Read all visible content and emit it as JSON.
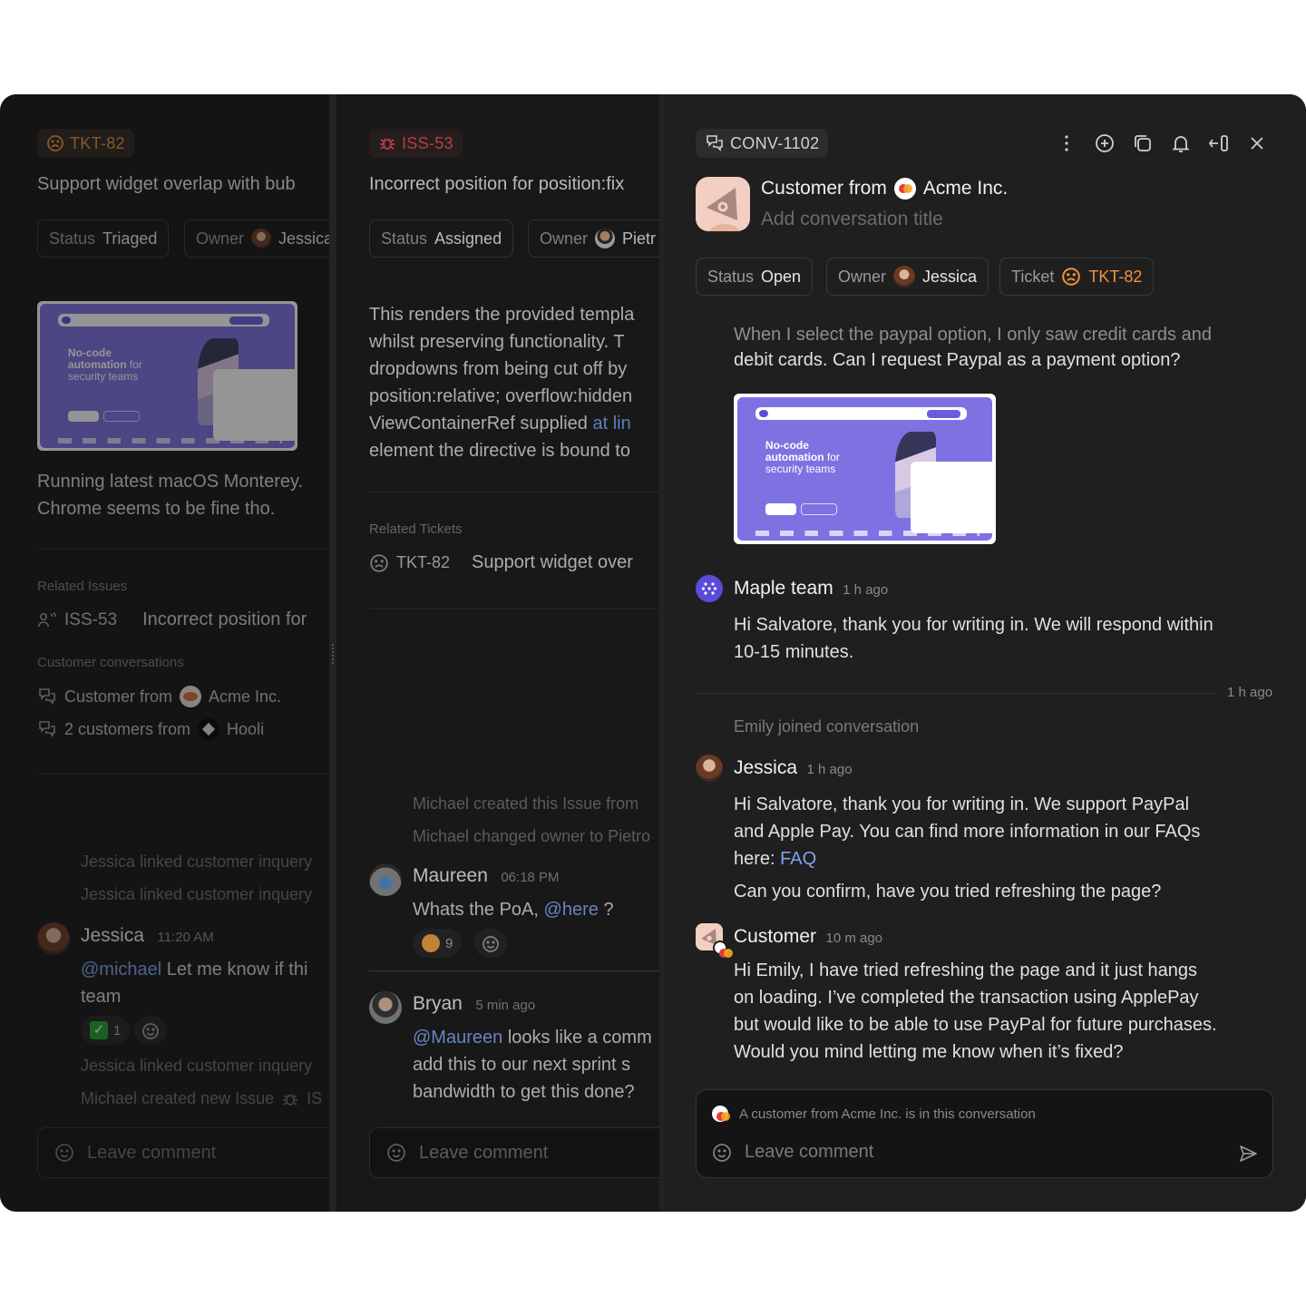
{
  "panels": {
    "ticket": {
      "id": "TKT-82",
      "title": "Support widget overlap with bub",
      "status_key": "Status",
      "status_value": "Triaged",
      "owner_key": "Owner",
      "owner_name": "Jessica",
      "description": [
        "Running latest macOS Monterey.",
        "Chrome seems to be fine tho."
      ],
      "attachment": {
        "headline_bold": "No-code automation",
        "headline_rest": "for security teams"
      },
      "related_issues_label": "Related Issues",
      "related_issues": [
        {
          "id": "ISS-53",
          "title": "Incorrect position for"
        }
      ],
      "customer_conversations_label": "Customer conversations",
      "customer_conversations": [
        {
          "prefix": "Customer from",
          "company": "Acme Inc."
        },
        {
          "prefix": "2 customers from",
          "company": "Hooli"
        }
      ],
      "activity": [
        "Jessica linked customer inquery",
        "Jessica linked customer inquery"
      ],
      "message": {
        "author": "Jessica",
        "time": "11:20 AM",
        "mention": "@michael",
        "text_line1": "Let me know if thi",
        "text_line2": "team",
        "reactions": [
          {
            "emoji": "✅",
            "count": "1"
          }
        ]
      },
      "activity_after": [
        "Jessica linked customer inquery",
        "Michael created new Issue"
      ],
      "activity_after_issue_ref": "IS",
      "comment_placeholder": "Leave comment"
    },
    "issue": {
      "id": "ISS-53",
      "title": "Incorrect position for position:fix",
      "status_key": "Status",
      "status_value": "Assigned",
      "owner_key": "Owner",
      "owner_name": "Pietr",
      "description": [
        "This renders the provided templa",
        "whilst preserving functionality. T",
        "dropdowns from being cut off by",
        "position:relative; overflow:hidden",
        "ViewContainerRef supplied",
        "element the directive is bound to"
      ],
      "description_link": "at lin",
      "related_tickets_label": "Related Tickets",
      "related_tickets": [
        {
          "id": "TKT-82",
          "title": "Support widget over"
        }
      ],
      "activity": [
        "Michael created this Issue from",
        "Michael changed owner to Pietro"
      ],
      "messages": [
        {
          "author": "Maureen",
          "time": "06:18 PM",
          "text": "Whats the PoA,",
          "mention": "@here",
          "text_after": "?",
          "reactions": [
            {
              "emoji": "😓",
              "count": "9"
            }
          ]
        },
        {
          "author": "Bryan",
          "time": "5 min ago",
          "mention": "@Maureen",
          "lines": [
            "looks like a comm",
            "add this to our next sprint s",
            "bandwidth to get this done?"
          ]
        }
      ],
      "comment_placeholder": "Leave comment"
    },
    "conversation": {
      "id": "CONV-1102",
      "header_prefix": "Customer from",
      "company": "Acme Inc.",
      "title_placeholder": "Add conversation title",
      "status_key": "Status",
      "status_value": "Open",
      "owner_key": "Owner",
      "owner_name": "Jessica",
      "ticket_key": "Ticket",
      "ticket_value": "TKT-82",
      "toolbar": [
        "more-icon",
        "add-icon",
        "copy-icon",
        "bell-icon",
        "collapse-icon",
        "close-icon"
      ],
      "first_message_lines": [
        "When I select the paypal option, I only saw credit cards and",
        "debit cards. Can I request Paypal as a payment option?"
      ],
      "attachment": {
        "headline_bold": "No-code automation",
        "headline_rest": "for security teams"
      },
      "messages": [
        {
          "author": "Maple team",
          "time": "1 h ago",
          "lines": [
            "Hi Salvatore, thank you for writing in. We will respond within",
            "10-15 minutes."
          ]
        },
        {
          "author": "Jessica",
          "time": "1 h ago",
          "lines": [
            "Hi Salvatore, thank you for writing in. We support PayPal",
            "and Apple Pay. You can find more information in our FAQs",
            "here:"
          ],
          "link": "FAQ",
          "extra": "Can you confirm, have you tried refreshing the page?"
        },
        {
          "author": "Customer",
          "time": "10 m ago",
          "lines": [
            "Hi Emily, I have tried refreshing the page and it just hangs",
            "on loading. I’ve completed the transaction using ApplePay",
            "but would like to be able to use PayPal for future purchases.",
            "Would you mind letting me know when it’s fixed?"
          ]
        }
      ],
      "separator_time": "1 h ago",
      "system_event": "Emily joined conversation",
      "composer_notice": "A customer from Acme Inc. is in this conversation",
      "comment_placeholder": "Leave comment"
    }
  },
  "colors": {
    "ticket_orange": "#e8913a",
    "issue_red": "#e5484d",
    "link_blue": "#7ea2f0",
    "maple_purple": "#5b4bdb"
  }
}
